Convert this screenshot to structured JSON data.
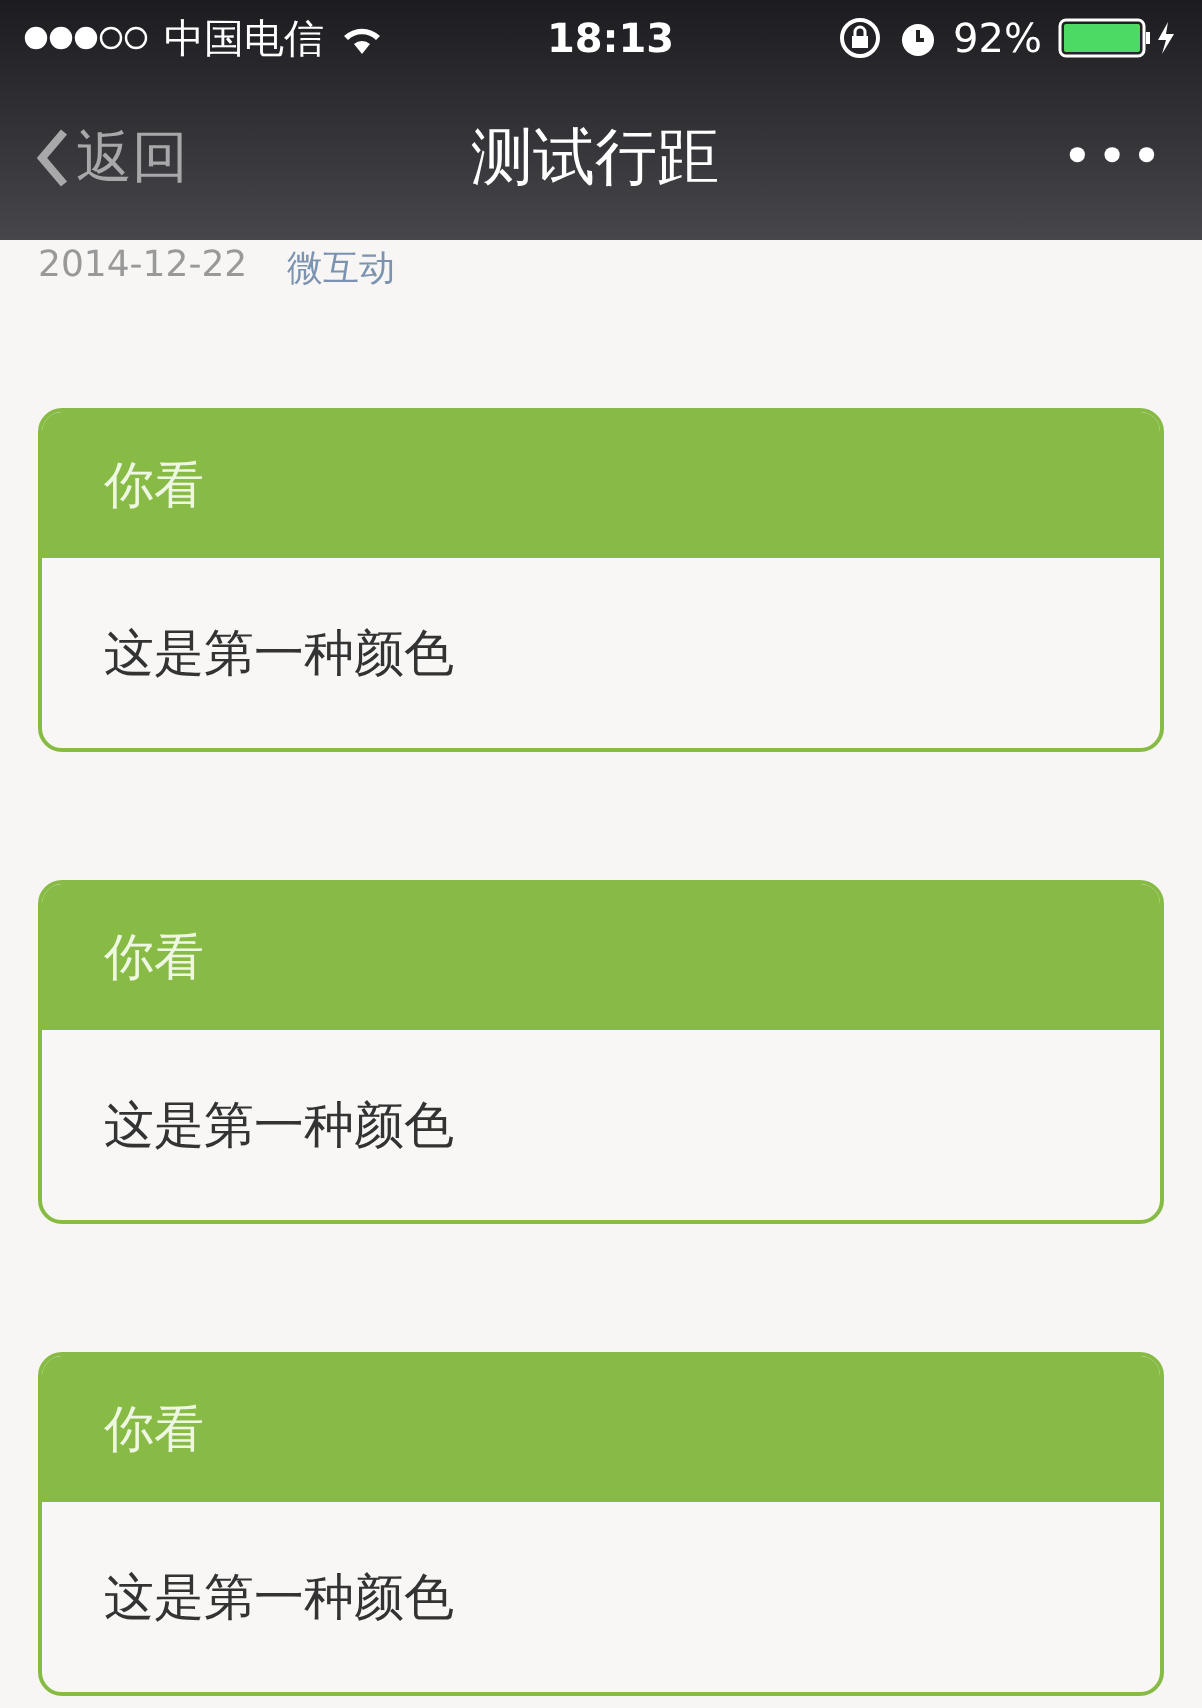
{
  "status_bar": {
    "carrier": "中国电信",
    "time": "18:13",
    "battery": "92%"
  },
  "nav_bar": {
    "back": "返回",
    "title": "测试行距",
    "more": "•••"
  },
  "meta": {
    "date": "2014-12-22",
    "source": "微互动"
  },
  "cards": [
    {
      "header": "你看",
      "body": "这是第一种颜色"
    },
    {
      "header": "你看",
      "body": "这是第一种颜色"
    },
    {
      "header": "你看",
      "body": "这是第一种颜色"
    }
  ]
}
